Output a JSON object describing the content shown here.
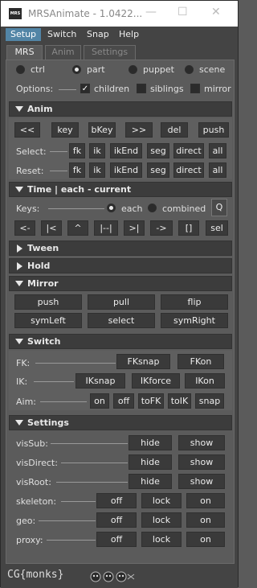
{
  "window": {
    "title": "MRSAnimate - 1.0422...",
    "app_icon_text": "MRS"
  },
  "menubar": [
    "Setup",
    "Switch",
    "Snap",
    "Help"
  ],
  "tabs": [
    "MRS",
    "Anim",
    "Settings"
  ],
  "scope": {
    "options": [
      "ctrl",
      "part",
      "puppet",
      "scene"
    ],
    "selected": "part"
  },
  "options": {
    "label": "Options:",
    "items": [
      {
        "label": "children",
        "checked": true
      },
      {
        "label": "siblings",
        "checked": false
      },
      {
        "label": "mirror",
        "checked": false
      }
    ]
  },
  "anim": {
    "title": "Anim",
    "buttons": [
      "<<",
      "key",
      "bKey",
      ">>",
      "del",
      "push"
    ],
    "select_label": "Select:",
    "reset_label": "Reset:",
    "row_buttons": [
      "fk",
      "ik",
      "ikEnd",
      "seg",
      "direct",
      "all"
    ]
  },
  "time": {
    "title": "Time | each - current",
    "keys_label": "Keys:",
    "modes": [
      "each",
      "combined"
    ],
    "selected": "each",
    "q_label": "Q",
    "buttons": [
      "<-",
      "|<",
      "^",
      "|--|",
      ">|",
      "->",
      "[]",
      "sel"
    ]
  },
  "tween": {
    "title": "Tween"
  },
  "hold": {
    "title": "Hold"
  },
  "mirror": {
    "title": "Mirror",
    "buttons": [
      "push",
      "pull",
      "flip",
      "symLeft",
      "select",
      "symRight"
    ]
  },
  "switch": {
    "title": "Switch",
    "fk_label": "FK:",
    "fk_buttons": [
      "FKsnap",
      "FKon"
    ],
    "ik_label": "IK:",
    "ik_buttons": [
      "IKsnap",
      "IKforce",
      "IKon"
    ],
    "aim_label": "Aim:",
    "aim_buttons": [
      "on",
      "off",
      "toFK",
      "toIK",
      "snap"
    ]
  },
  "settings": {
    "title": "Settings",
    "vis_rows": [
      {
        "label": "visSub:",
        "buttons": [
          "hide",
          "show"
        ]
      },
      {
        "label": "visDirect:",
        "buttons": [
          "hide",
          "show"
        ]
      },
      {
        "label": "visRoot:",
        "buttons": [
          "hide",
          "show"
        ]
      }
    ],
    "state_rows": [
      {
        "label": "skeleton:",
        "buttons": [
          "off",
          "lock",
          "on"
        ]
      },
      {
        "label": "geo:",
        "buttons": [
          "off",
          "lock",
          "on"
        ]
      },
      {
        "label": "proxy:",
        "buttons": [
          "off",
          "lock",
          "on"
        ]
      }
    ]
  },
  "footer": {
    "logo": "CG{monks}"
  },
  "colors": {
    "menu_active": "#5285a6",
    "button": "#3a3a3a",
    "panel": "#5b5b5b",
    "header": "#3c3c3c"
  }
}
